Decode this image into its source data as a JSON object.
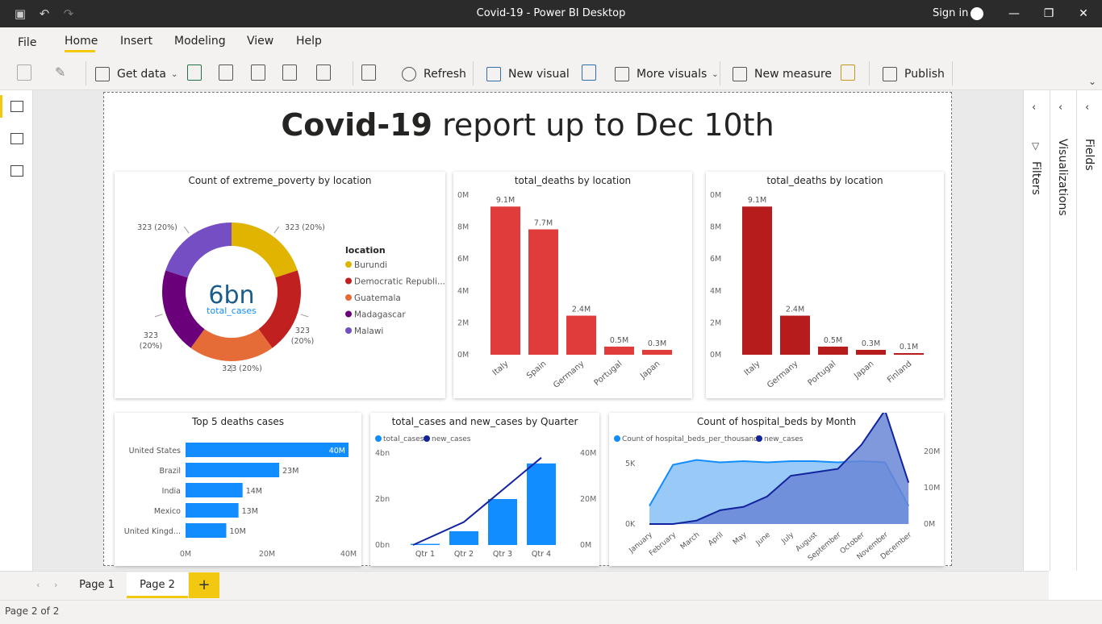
{
  "window": {
    "title": "Covid-19 - Power BI Desktop",
    "signin": "Sign in"
  },
  "menu": {
    "file": "File",
    "home": "Home",
    "insert": "Insert",
    "modeling": "Modeling",
    "view": "View",
    "help": "Help"
  },
  "ribbon": {
    "get_data": "Get data",
    "refresh": "Refresh",
    "new_visual": "New visual",
    "more_visuals": "More visuals",
    "new_measure": "New measure",
    "publish": "Publish"
  },
  "report": {
    "title_bold": "Covid-19",
    "title_rest": " report up to Dec 10th"
  },
  "donut": {
    "title": "Count of extreme_poverty by location",
    "center_value": "6bn",
    "center_label": "total_cases",
    "legend_title": "location",
    "slices": [
      {
        "name": "Burundi",
        "label": "Burundi",
        "value": 323,
        "pct": 20,
        "color": "#e0b400",
        "tag": "323 (20%)"
      },
      {
        "name": "Democratic Republic of Congo",
        "label": "Democratic Republi...",
        "value": 323,
        "pct": 20,
        "color": "#c0201f",
        "tag": "323 (20%)"
      },
      {
        "name": "Guatemala",
        "label": "Guatemala",
        "value": 323,
        "pct": 20,
        "color": "#e66c37",
        "tag": "323 (20%)"
      },
      {
        "name": "Madagascar",
        "label": "Madagascar",
        "value": 323,
        "pct": 20,
        "color": "#6b007b",
        "tag": "323 (20%)"
      },
      {
        "name": "Malawi",
        "label": "Malawi",
        "value": 323,
        "pct": 20,
        "color": "#744ec2",
        "tag": "323 (20%)"
      }
    ]
  },
  "chart_data": [
    {
      "type": "bar",
      "title": "total_deaths by location",
      "categories": [
        "Italy",
        "Spain",
        "Germany",
        "Portugal",
        "Japan"
      ],
      "values": [
        9.1,
        7.7,
        2.4,
        0.5,
        0.3
      ],
      "labels": [
        "9.1M",
        "7.7M",
        "2.4M",
        "0.5M",
        "0.3M"
      ],
      "yticks": [
        "0M",
        "2M",
        "4M",
        "6M",
        "8M",
        "0M"
      ],
      "ylim": [
        0,
        10
      ],
      "color": "#e03c3c"
    },
    {
      "type": "bar",
      "title": "total_deaths by location",
      "categories": [
        "Italy",
        "Germany",
        "Portugal",
        "Japan",
        "Finland"
      ],
      "values": [
        9.1,
        2.4,
        0.5,
        0.3,
        0.1
      ],
      "labels": [
        "9.1M",
        "2.4M",
        "0.5M",
        "0.3M",
        "0.1M"
      ],
      "yticks": [
        "0M",
        "2M",
        "4M",
        "6M",
        "8M",
        "0M"
      ],
      "ylim": [
        0,
        10
      ],
      "color": "#b71c1c"
    },
    {
      "type": "bar",
      "orientation": "horizontal",
      "title": "Top 5 deaths cases",
      "categories": [
        "United States",
        "Brazil",
        "India",
        "Mexico",
        "United Kingd..."
      ],
      "values": [
        40,
        23,
        14,
        13,
        10
      ],
      "labels": [
        "40M",
        "23M",
        "14M",
        "13M",
        "10M"
      ],
      "xticks": [
        "0M",
        "20M",
        "40M"
      ],
      "xlim": [
        0,
        40
      ],
      "color": "#118dff"
    },
    {
      "type": "bar",
      "title": "total_cases and new_cases by Quarter",
      "categories": [
        "Qtr 1",
        "Qtr 2",
        "Qtr 3",
        "Qtr 4"
      ],
      "legend": [
        "total_cases",
        "new_cases"
      ],
      "series": [
        {
          "name": "total_cases",
          "values": [
            0.05,
            0.6,
            2.0,
            3.55
          ],
          "color": "#118dff"
        },
        {
          "name": "new_cases",
          "values": [
            0,
            10,
            24,
            38
          ],
          "color": "#12239e"
        }
      ],
      "yticks_left": [
        "0bn",
        "2bn",
        "4bn"
      ],
      "yticks_right": [
        "0M",
        "20M",
        "40M"
      ],
      "ylim_left": [
        0,
        4
      ],
      "ylim_right": [
        0,
        40
      ]
    },
    {
      "type": "area",
      "title": "Count of hospital_beds by Month",
      "categories": [
        "January",
        "February",
        "March",
        "April",
        "May",
        "June",
        "July",
        "August",
        "September",
        "October",
        "November",
        "December"
      ],
      "legend": [
        "Count of hospital_beds_per_thousand",
        "new_cases"
      ],
      "series": [
        {
          "name": "Count of hospital_beds_per_thousand",
          "values": [
            1.5,
            4.9,
            5.3,
            5.1,
            5.2,
            5.1,
            5.2,
            5.2,
            5.1,
            5.2,
            5.1,
            1.5
          ],
          "color": "#118dff"
        },
        {
          "name": "new_cases",
          "values": [
            0,
            0,
            1,
            4,
            5,
            8,
            14,
            15,
            16,
            23,
            33,
            12
          ],
          "color": "#12239e"
        }
      ],
      "yticks_left": [
        "0K",
        "5K"
      ],
      "yticks_right": [
        "0M",
        "10M",
        "20M"
      ],
      "ylim_left": [
        0,
        6
      ],
      "ylim_right": [
        0,
        20
      ]
    }
  ],
  "panes": {
    "filters": "Filters",
    "visualizations": "Visualizations",
    "fields": "Fields"
  },
  "tabs": {
    "page1": "Page 1",
    "page2": "Page 2",
    "add": "+"
  },
  "status": {
    "page_info": "Page 2 of 2"
  }
}
